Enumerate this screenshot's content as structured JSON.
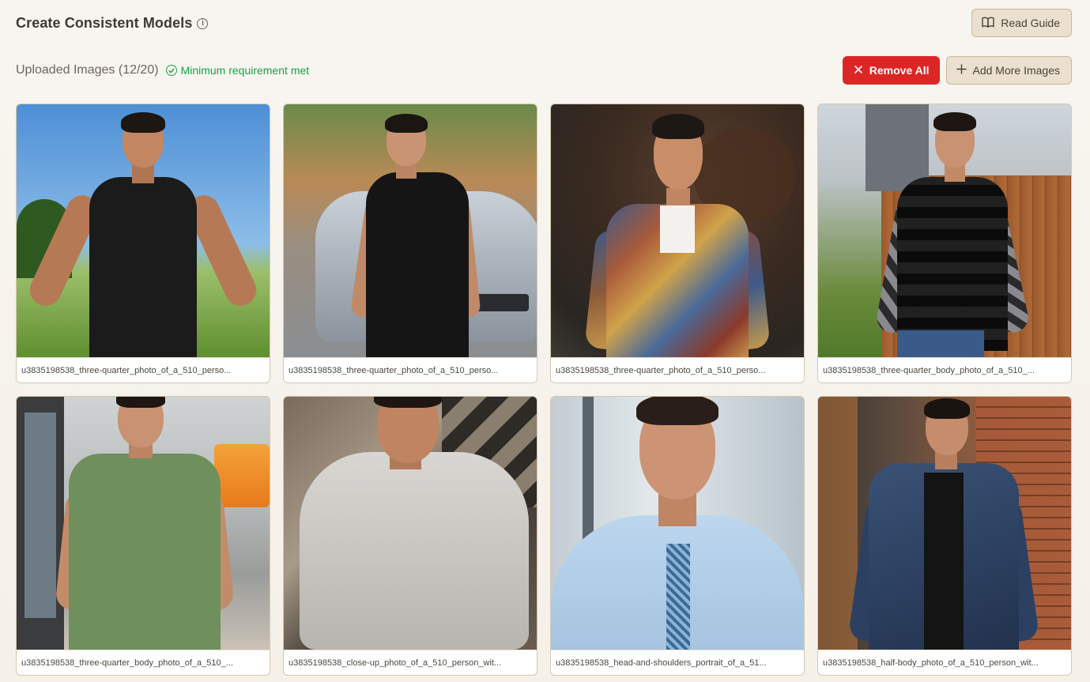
{
  "header": {
    "title": "Create Consistent Models",
    "info_icon": "info-icon",
    "read_guide_label": "Read Guide",
    "read_guide_icon": "book-icon"
  },
  "subheader": {
    "uploaded_label": "Uploaded Images (12/20)",
    "status_text": "Minimum requirement met",
    "status_icon": "check-circle-icon",
    "remove_all_label": "Remove All",
    "remove_all_icon": "close-icon",
    "add_more_label": "Add More Images",
    "add_more_icon": "plus-icon"
  },
  "colors": {
    "accent_red": "#dc2626",
    "success_green": "#16a34a",
    "beige_button": "#ebe0cf"
  },
  "images": [
    {
      "caption": "u3835198538_three-quarter_photo_of_a_510_perso..."
    },
    {
      "caption": "u3835198538_three-quarter_photo_of_a_510_perso..."
    },
    {
      "caption": "u3835198538_three-quarter_photo_of_a_510_perso..."
    },
    {
      "caption": "u3835198538_three-quarter_body_photo_of_a_510_..."
    },
    {
      "caption": "u3835198538_three-quarter_body_photo_of_a_510_..."
    },
    {
      "caption": "u3835198538_close-up_photo_of_a_510_person_wit..."
    },
    {
      "caption": "u3835198538_head-and-shoulders_portrait_of_a_51..."
    },
    {
      "caption": "u3835198538_half-body_photo_of_a_510_person_wit..."
    }
  ]
}
